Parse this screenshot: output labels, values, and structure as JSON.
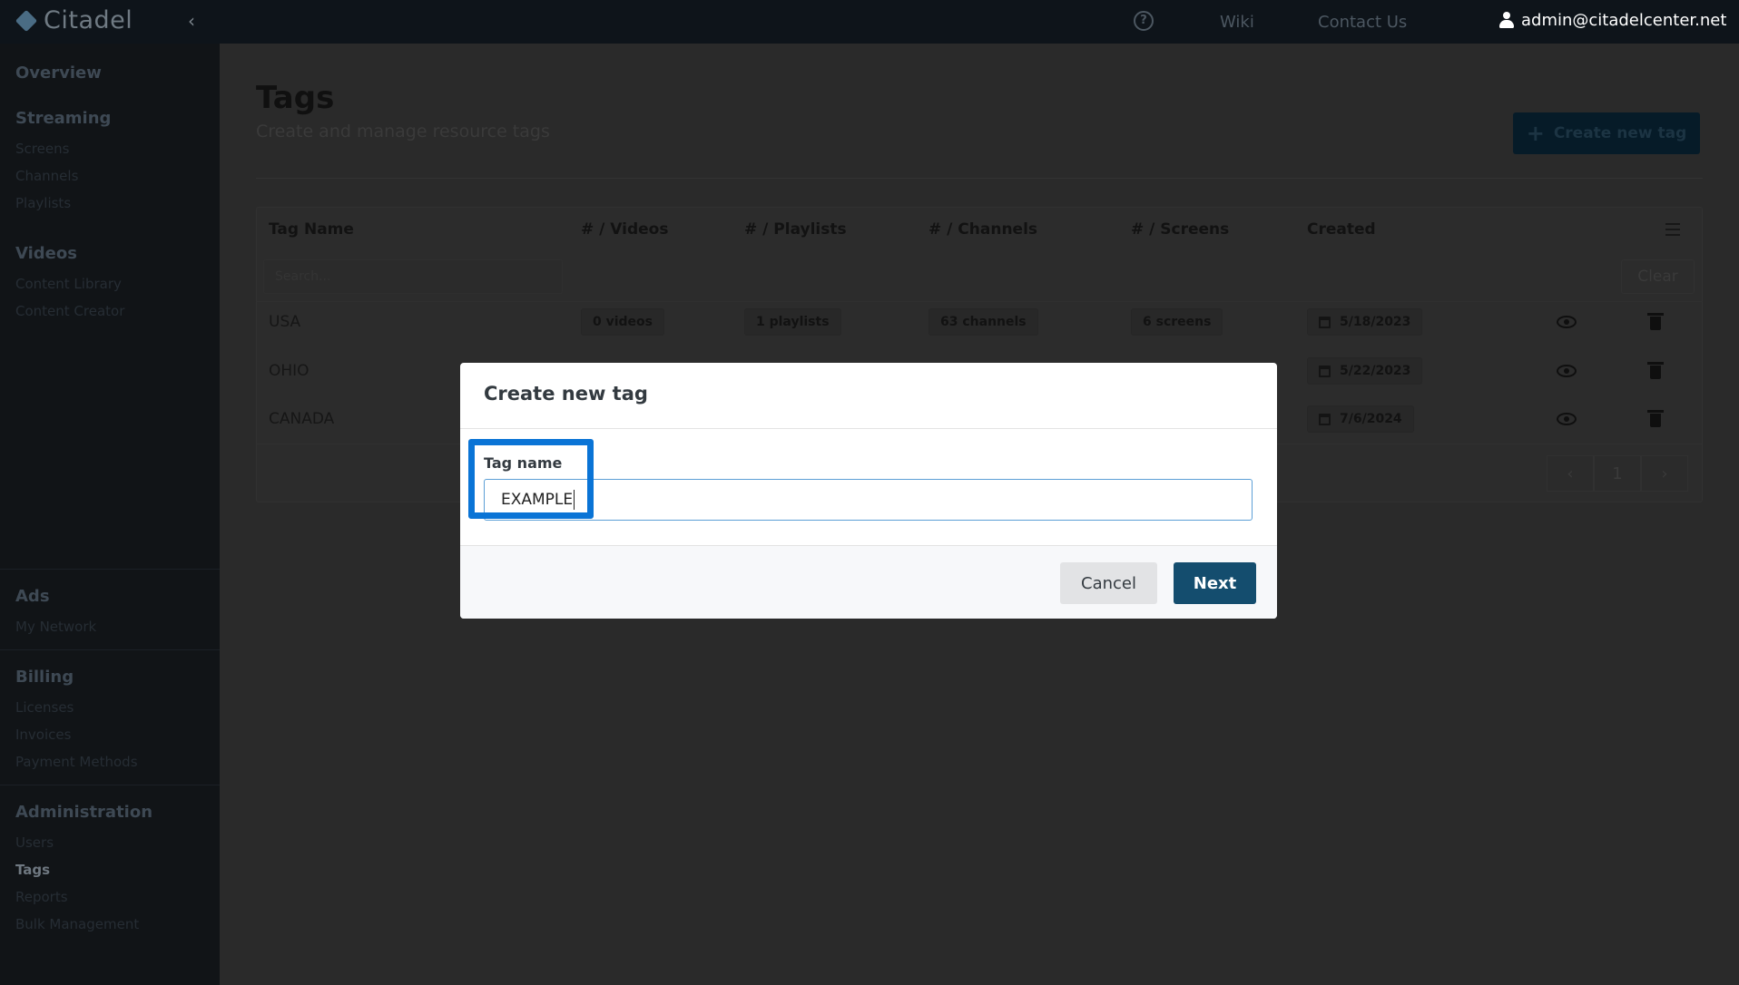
{
  "app": {
    "name": "Citadel",
    "collapse_glyph": "‹"
  },
  "topnav": {
    "help_glyph": "?",
    "wiki": "Wiki",
    "contact": "Contact Us",
    "user_email": "admin@citadelcenter.net"
  },
  "sidebar": {
    "overview": "Overview",
    "streaming": {
      "title": "Streaming",
      "items": [
        "Screens",
        "Channels",
        "Playlists"
      ]
    },
    "videos": {
      "title": "Videos",
      "items": [
        "Content Library",
        "Content Creator"
      ]
    },
    "ads": {
      "title": "Ads",
      "items": [
        "My Network"
      ]
    },
    "billing": {
      "title": "Billing",
      "items": [
        "Licenses",
        "Invoices",
        "Payment Methods"
      ]
    },
    "administration": {
      "title": "Administration",
      "items": [
        "Users",
        "Tags",
        "Reports",
        "Bulk Management"
      ],
      "active": "Tags"
    }
  },
  "page": {
    "title": "Tags",
    "subtitle": "Create and manage resource tags",
    "create_button": "Create new tag",
    "create_button_icon": "+"
  },
  "table": {
    "columns": [
      "Tag Name",
      "# / Videos",
      "# / Playlists",
      "# / Channels",
      "# / Screens",
      "Created"
    ],
    "search_placeholder": "Search...",
    "clear_label": "Clear",
    "rows": [
      {
        "name": "USA",
        "videos": "0 videos",
        "playlists": "1 playlists",
        "channels": "63 channels",
        "screens": "6 screens",
        "created": "5/18/2023"
      },
      {
        "name": "OHIO",
        "created": "5/22/2023"
      },
      {
        "name": "CANADA",
        "created": "7/6/2024"
      }
    ],
    "pagination": {
      "prev": "‹",
      "page": "1",
      "next": "›"
    }
  },
  "modal": {
    "title": "Create new tag",
    "field_label": "Tag name",
    "field_value": "EXAMPLE",
    "cancel": "Cancel",
    "next": "Next"
  },
  "colors": {
    "highlight": "#0a74d6",
    "primary_button": "#144d6e",
    "input_focus_border": "#5c9fd6"
  }
}
